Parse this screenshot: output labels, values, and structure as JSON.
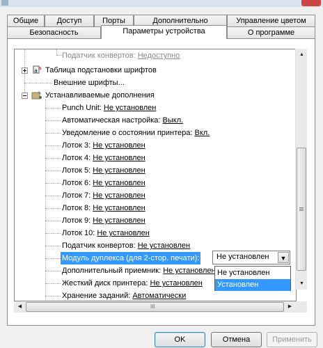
{
  "tabs_row1": [
    {
      "label": "Общие"
    },
    {
      "label": "Доступ"
    },
    {
      "label": "Порты"
    },
    {
      "label": "Дополнительно"
    },
    {
      "label": "Управление цветом"
    }
  ],
  "tabs_row2": [
    {
      "label": "Безопасность"
    },
    {
      "label": "Параметры устройства",
      "active": true
    },
    {
      "label": "О программе"
    }
  ],
  "tree": {
    "top_item": {
      "label": "Податчик конвертов: ",
      "value": "Недоступно"
    },
    "font_table": "Таблица подстановки шрифтов",
    "external_fonts": "Внешние шрифты...",
    "options_group": "Устанавливаемые дополнения",
    "items": [
      {
        "label": "Punch Unit: ",
        "value": "Не установлен"
      },
      {
        "label": "Автоматическая настройка: ",
        "value": "Выкл."
      },
      {
        "label": "Уведомление о состоянии принтера: ",
        "value": "Вкл."
      },
      {
        "label": "Лоток 3: ",
        "value": "Не установлен"
      },
      {
        "label": "Лоток 4: ",
        "value": "Не установлен"
      },
      {
        "label": "Лоток 5: ",
        "value": "Не установлен"
      },
      {
        "label": "Лоток 6: ",
        "value": "Не установлен"
      },
      {
        "label": "Лоток 7: ",
        "value": "Не установлен"
      },
      {
        "label": "Лоток 8: ",
        "value": "Не установлен"
      },
      {
        "label": "Лоток 9: ",
        "value": "Не установлен"
      },
      {
        "label": "Лоток 10: ",
        "value": "Не установлен"
      },
      {
        "label": "Податчик конвертов: ",
        "value": "Не установлен"
      },
      {
        "label": "Модуль дуплекса (для 2-стор. печати):",
        "value": ""
      },
      {
        "label": "Дополнительный приемник: ",
        "value": "Не установлен"
      },
      {
        "label": "Жесткий диск принтера: ",
        "value": "Не установлен"
      },
      {
        "label": "Хранение заданий: ",
        "value": "Автоматически"
      }
    ]
  },
  "duplex_combo": {
    "value": "Не установлен",
    "options": [
      "Не установлен",
      "Установлен"
    ],
    "highlighted": "Установлен"
  },
  "hscroll_grip": "III",
  "buttons": {
    "ok": "OK",
    "cancel": "Отмена",
    "apply": "Применить"
  },
  "colors": {
    "selection": "#3399ff",
    "panel": "#ffffff",
    "dialog": "#f0f0f0"
  }
}
